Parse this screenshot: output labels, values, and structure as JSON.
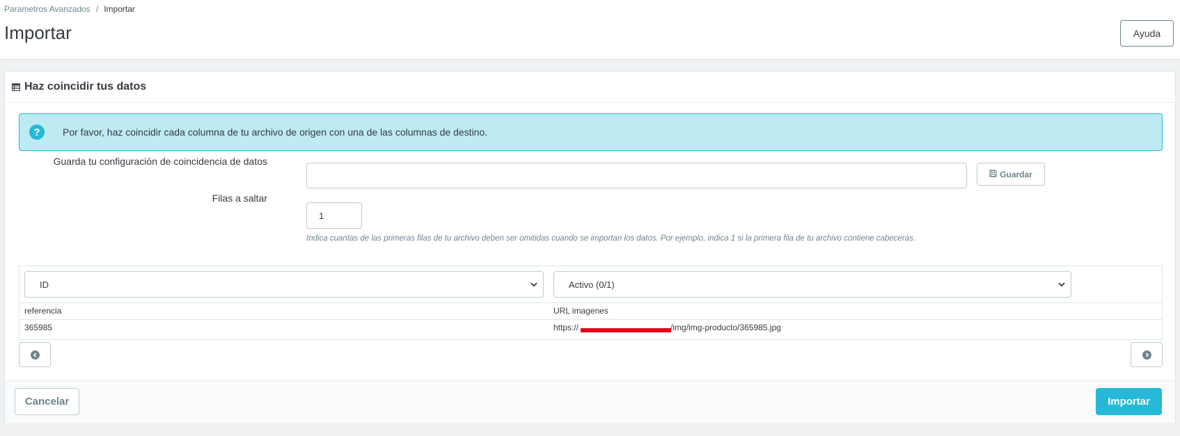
{
  "breadcrumb": {
    "parent": "Parametros Avanzados",
    "separator": "/",
    "current": "Importar"
  },
  "page": {
    "title": "Importar",
    "help_label": "Ayuda"
  },
  "panel": {
    "heading": "Haz coincidir tus datos",
    "heading_icon": "table-icon",
    "alert_icon": "question-circle-icon",
    "alert_text": "Por favor, haz coincidir cada columna de tu archivo de origen con una de las columnas de destino.",
    "save_config": {
      "label": "Guarda tu configuración de coincidencia de datos",
      "value": "",
      "button_label": "Guardar",
      "button_icon": "floppy-disk-icon"
    },
    "skip_rows": {
      "label": "Filas a saltar",
      "value": "1",
      "help": "Indica cuantas de las primeras filas de tu archivo deben ser omitidas cuando se importan los datos. Por ejemplo, indica 1 si la primera fila de tu archivo contiene cabeceras."
    }
  },
  "matching": {
    "columns": [
      {
        "selected": "ID",
        "header": "referencia",
        "values": [
          "365985"
        ]
      },
      {
        "selected": "Activo (0/1)",
        "header": "URL imagenes",
        "values_prefix": "https://",
        "values_suffix": "/img/img-producto/365985.jpg"
      }
    ],
    "prev_icon": "chevron-left-circle-icon",
    "next_icon": "chevron-right-circle-icon"
  },
  "footer": {
    "cancel_label": "Cancelar",
    "import_label": "Importar"
  },
  "colors": {
    "accent": "#25b9d7",
    "alert_bg": "#beeaf3",
    "redaction": "#e2001a"
  }
}
